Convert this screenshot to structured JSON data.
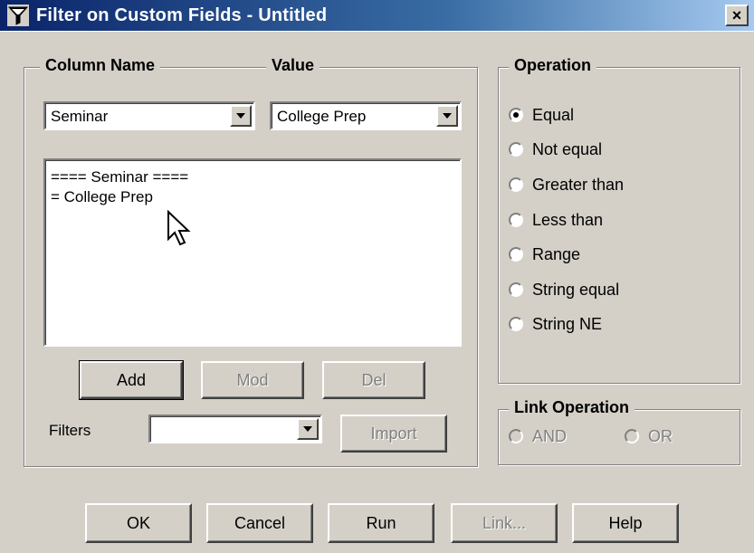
{
  "window": {
    "title": "Filter on Custom Fields  - Untitled",
    "close_label": "×"
  },
  "column_name": {
    "label": "Column Name",
    "selected": "Seminar"
  },
  "value": {
    "label": "Value",
    "selected": "College Prep"
  },
  "filter_list": [
    "==== Seminar ====",
    "= College Prep"
  ],
  "edit_buttons": {
    "add": "Add",
    "mod": "Mod",
    "del": "Del"
  },
  "filters": {
    "label": "Filters",
    "selected": "",
    "import": "Import"
  },
  "operation": {
    "label": "Operation",
    "options": [
      "Equal",
      "Not equal",
      "Greater than",
      "Less than",
      "Range",
      "String equal",
      "String NE"
    ],
    "selected": "Equal"
  },
  "link_operation": {
    "label": "Link Operation",
    "options": [
      "AND",
      "OR"
    ]
  },
  "footer": {
    "ok": "OK",
    "cancel": "Cancel",
    "run": "Run",
    "link": "Link...",
    "help": "Help"
  },
  "colors": {
    "title_start": "#0a246a",
    "title_end": "#a6caf0",
    "face": "#d4d0c8"
  },
  "icons": {
    "title": "filter-funnel-icon",
    "close": "close-icon",
    "dropdown": "chevron-down-icon",
    "cursor": "mouse-pointer-icon"
  }
}
